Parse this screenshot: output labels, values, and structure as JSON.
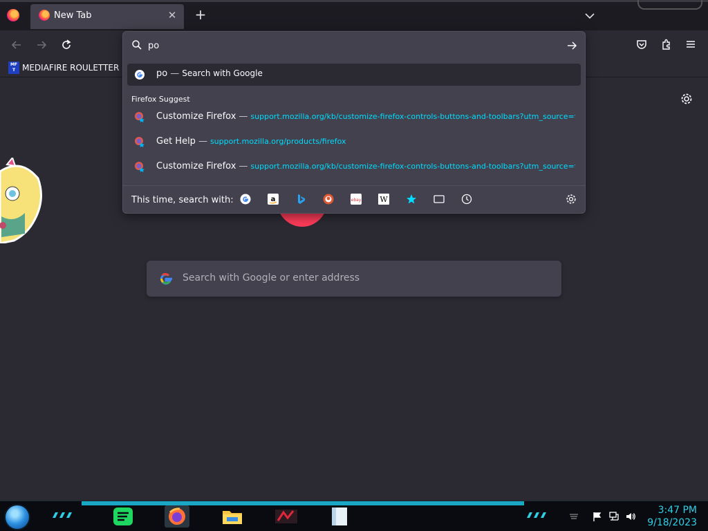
{
  "tabs": [
    {
      "title": "New Tab",
      "active": true
    }
  ],
  "navbar": {
    "url_value": "po"
  },
  "bookmarks": [
    {
      "label": "MEDIAFIRE ROULETTER",
      "icon_text": "MF T"
    }
  ],
  "urlbar": {
    "results": [
      {
        "title": "po",
        "action": "Search with Google",
        "icon": "google-icon"
      }
    ],
    "group_label": "Firefox Suggest",
    "suggestions": [
      {
        "title": "Customize Firefox",
        "url": "support.mozilla.org/kb/customize-firefox-controls-buttons-and-toolbars?utm_source=fir"
      },
      {
        "title": "Get Help",
        "url": "support.mozilla.org/products/firefox"
      },
      {
        "title": "Customize Firefox",
        "url": "support.mozilla.org/kb/customize-firefox-controls-buttons-and-toolbars?utm_source=fir"
      }
    ],
    "oneoff_label": "This time, search with:",
    "oneoff_engines": [
      "google-icon",
      "amazon-icon",
      "bing-icon",
      "duckduckgo-icon",
      "ebay-icon",
      "wikipedia-icon",
      "bookmarks-star-icon",
      "tabs-icon",
      "history-icon"
    ]
  },
  "page": {
    "search_placeholder": "Search with Google or enter address"
  },
  "taskbar": {
    "time": "3:47 PM",
    "date": "9/18/2023"
  },
  "colors": {
    "accent_link": "#00ddff",
    "popup_bg": "#42414d",
    "page_bg": "#2b2a33",
    "clock": "#2fd0e6"
  }
}
